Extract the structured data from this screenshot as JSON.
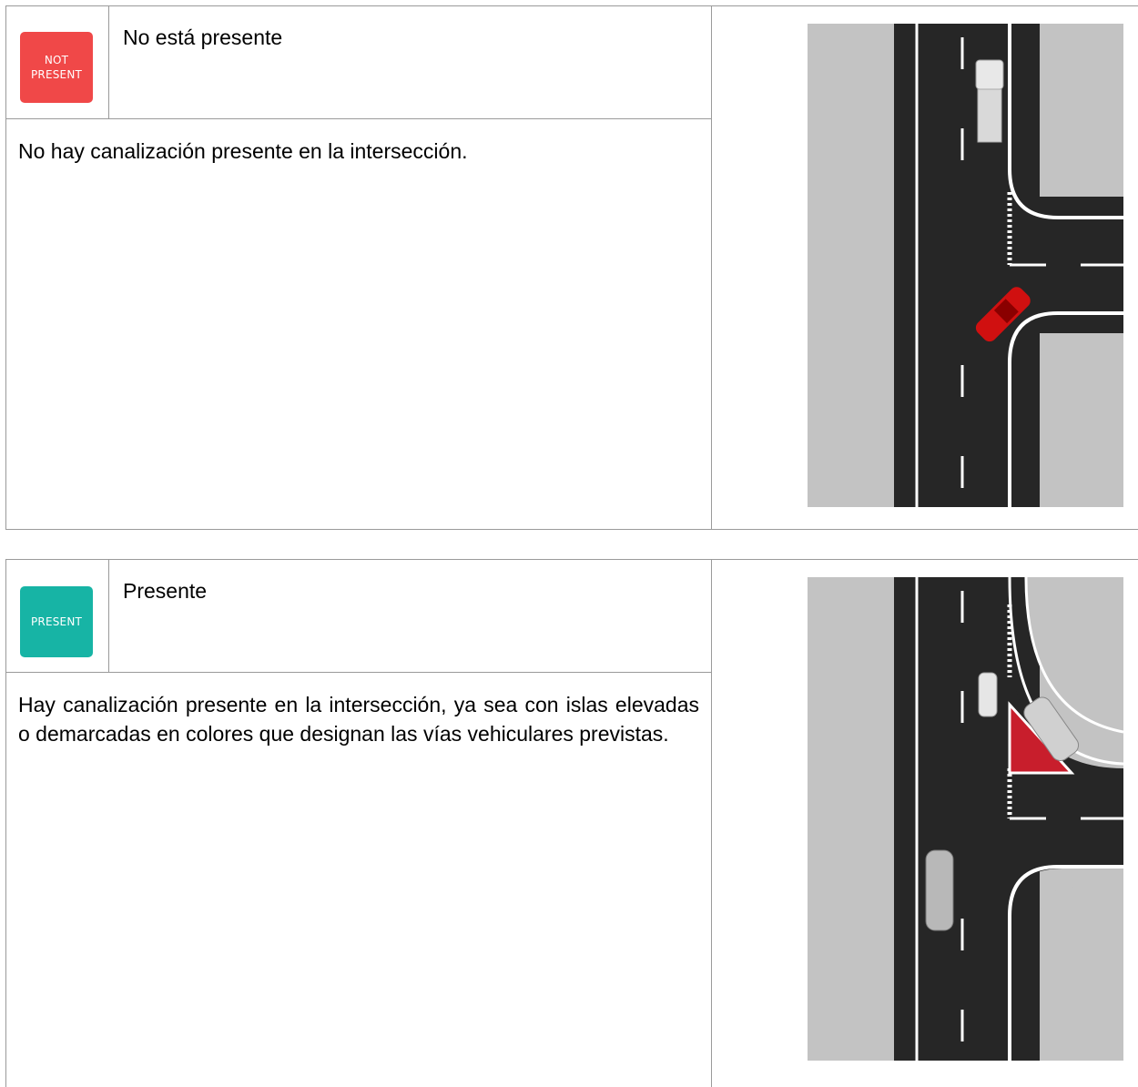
{
  "blocks": [
    {
      "badge": {
        "line1": "NOT",
        "line2": "PRESENT",
        "color": "#f04848"
      },
      "title": "No está presente",
      "description": "No hay canalización presente en la intersección.",
      "illustration": "t-intersection-without-channelization"
    },
    {
      "badge": {
        "line1": "PRESENT",
        "line2": "",
        "color": "#17b4a5"
      },
      "title": "Presente",
      "description": "Hay canalización presente en la intersección, ya sea con islas elevadas o demarcadas en colores que designan las vías vehiculares previstas.",
      "illustration": "t-intersection-with-channelized-island"
    }
  ]
}
